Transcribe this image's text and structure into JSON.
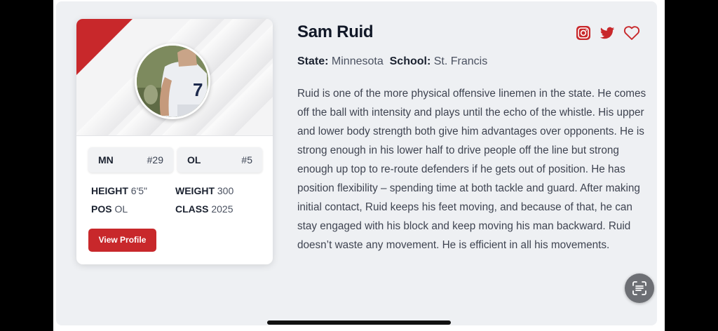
{
  "player": {
    "name": "Sam Ruid",
    "state_label": "State:",
    "state": "Minnesota",
    "school_label": "School:",
    "school": "St. Francis",
    "bio": "Ruid is one of the more physical offensive linemen in the state. He comes off the ball with intensity and plays until the echo of the whistle. His upper and lower body strength both give him advantages over opponents. He is strong enough in his lower half to drive people off the line but strong enough up top to re-route defenders if he gets out of position. He has position flexibility – spending time at both tackle and guard. After making initial contact, Ruid keeps his feet moving, and because of that, he can stay engaged with his block and keep moving his man backward. Ruid doesn’t waste any movement. He is efficient in all his movements."
  },
  "card": {
    "rank_state": {
      "label": "MN",
      "value": "#29"
    },
    "rank_pos": {
      "label": "OL",
      "value": "#5"
    },
    "stats": {
      "height_label": "HEIGHT",
      "height": "6'5\"",
      "weight_label": "WEIGHT",
      "weight": "300",
      "pos_label": "POS",
      "pos": "OL",
      "class_label": "CLASS",
      "class": "2025"
    },
    "view_profile_label": "View Profile",
    "accent": "#c8282b"
  },
  "icons": [
    "instagram-icon",
    "twitter-icon",
    "heart-icon",
    "text-scan-icon"
  ]
}
